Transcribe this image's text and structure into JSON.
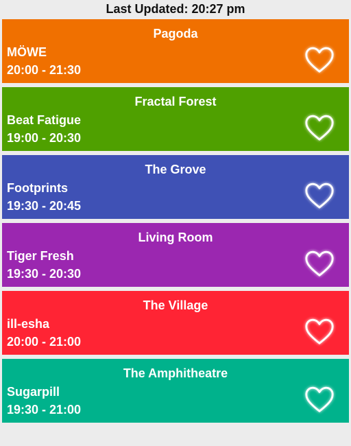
{
  "header": {
    "last_updated": "Last Updated: 20:27 pm"
  },
  "sets": [
    {
      "stage": "Pagoda",
      "artist": "MÖWE",
      "time": "20:00 - 21:30",
      "color": "#f07000",
      "favorite_icon": "heart-outline-icon"
    },
    {
      "stage": "Fractal Forest",
      "artist": "Beat Fatigue",
      "time": "19:00 - 20:30",
      "color": "#4fa000",
      "favorite_icon": "heart-outline-icon"
    },
    {
      "stage": "The Grove",
      "artist": "Footprints",
      "time": "19:30 - 20:45",
      "color": "#3f51b5",
      "favorite_icon": "heart-outline-icon"
    },
    {
      "stage": "Living Room",
      "artist": "Tiger Fresh",
      "time": "19:30 - 20:30",
      "color": "#9b27b0",
      "favorite_icon": "heart-outline-icon"
    },
    {
      "stage": "The Village",
      "artist": "ill-esha",
      "time": "20:00 - 21:00",
      "color": "#ff2434",
      "favorite_icon": "heart-outline-icon"
    },
    {
      "stage": "The Amphitheatre",
      "artist": "Sugarpill",
      "time": "19:30 - 21:00",
      "color": "#00b28c",
      "favorite_icon": "heart-outline-icon"
    }
  ]
}
